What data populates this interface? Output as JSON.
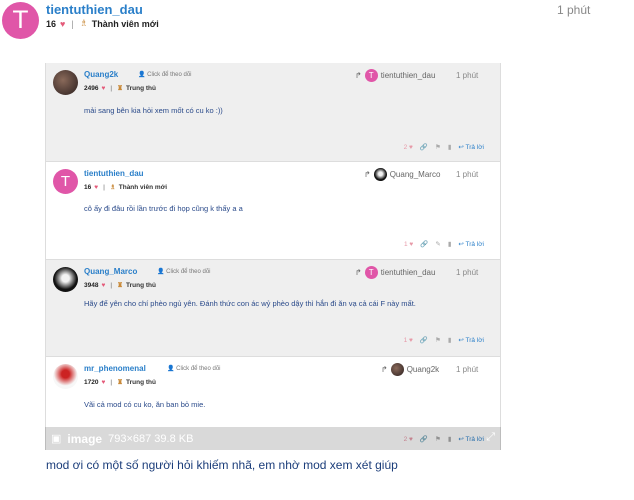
{
  "post": {
    "avatar_letter": "T",
    "username": "tientuthien_dau",
    "likes": "16",
    "badge": "Thành viên mới",
    "time": "1 phút",
    "body": "mod ơi có một số người hỏi khiếm nhã, em nhờ mod xem xét giúp"
  },
  "image_caption": {
    "title": "image",
    "info": "793×687 39.8 KB"
  },
  "cards": [
    {
      "username": "Quang2k",
      "follow": "Click để theo dõi",
      "likes": "2496",
      "rank": "Trung thủ",
      "reply_to": "tientuthien_dau",
      "reply_avatar_letter": "T",
      "time": "1 phút",
      "text": "mải sang bên kia hỏi xem mốt có cu ko :))",
      "like_count": "2",
      "reply_label": "Trả lời"
    },
    {
      "username": "tientuthien_dau",
      "avatar_letter": "T",
      "likes": "16",
      "rank": "Thành viên mới",
      "reply_to": "Quang_Marco",
      "time": "1 phút",
      "text": "cô ấy đi đâu rồi lần trước đi họp cũng k thấy a a",
      "like_count": "1",
      "reply_label": "Trả lời"
    },
    {
      "username": "Quang_Marco",
      "follow": "Click để theo dõi",
      "likes": "3948",
      "rank": "Trung thủ",
      "reply_to": "tientuthien_dau",
      "reply_avatar_letter": "T",
      "time": "1 phút",
      "text": "Hãy để yên cho chí phèo ngủ yên. Đánh thức con ác wỷ phèo dậy thì hắn đi ăn vạ cả cái F này mất.",
      "like_count": "1",
      "reply_label": "Trả lời"
    },
    {
      "username": "mr_phenomenal",
      "follow": "Click để theo dõi",
      "likes": "1720",
      "rank": "Trung thủ",
      "reply_to": "Quang2k",
      "time": "1 phút",
      "text": "Vãi cả mod có cu ko, ăn ban bỏ mie.",
      "like_count": "2",
      "reply_label": "Trả lời"
    }
  ]
}
